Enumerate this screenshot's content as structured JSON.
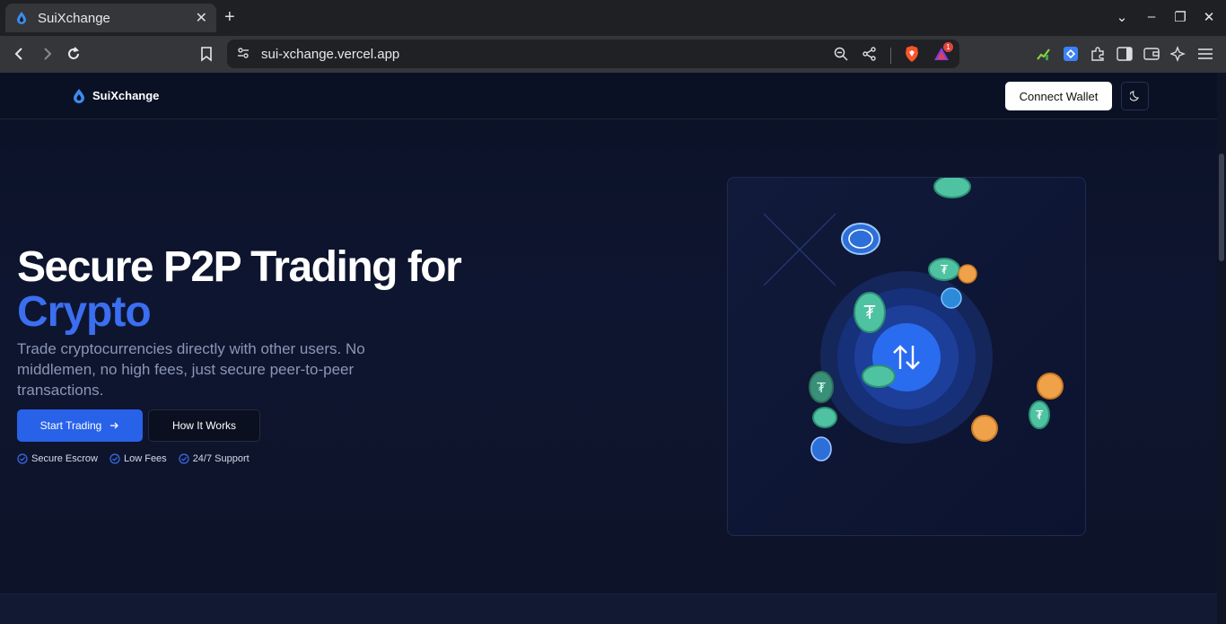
{
  "browser": {
    "tab_title": "SuiXchange",
    "new_tab": "+",
    "url": "sui-xchange.vercel.app",
    "brave_badge": "1"
  },
  "header": {
    "logo_text": "SuiXchange",
    "connect_wallet": "Connect Wallet",
    "theme_icon": "moon-icon"
  },
  "hero": {
    "title_line1": "Secure P2P Trading for",
    "title_line2": "Crypto",
    "subtitle": "Trade cryptocurrencies directly with other users. No middlemen, no high fees, just secure peer-to-peer transactions.",
    "start_trading": "Start Trading",
    "how_it_works": "How It Works",
    "features": [
      "Secure Escrow",
      "Low Fees",
      "24/7 Support"
    ]
  },
  "colors": {
    "accent": "#2862e9",
    "accent_text": "#3b6ef0",
    "background": "#0d1428",
    "tether": "#4fc3a1",
    "gold": "#f0a24a",
    "usdc": "#3a7bd5"
  }
}
